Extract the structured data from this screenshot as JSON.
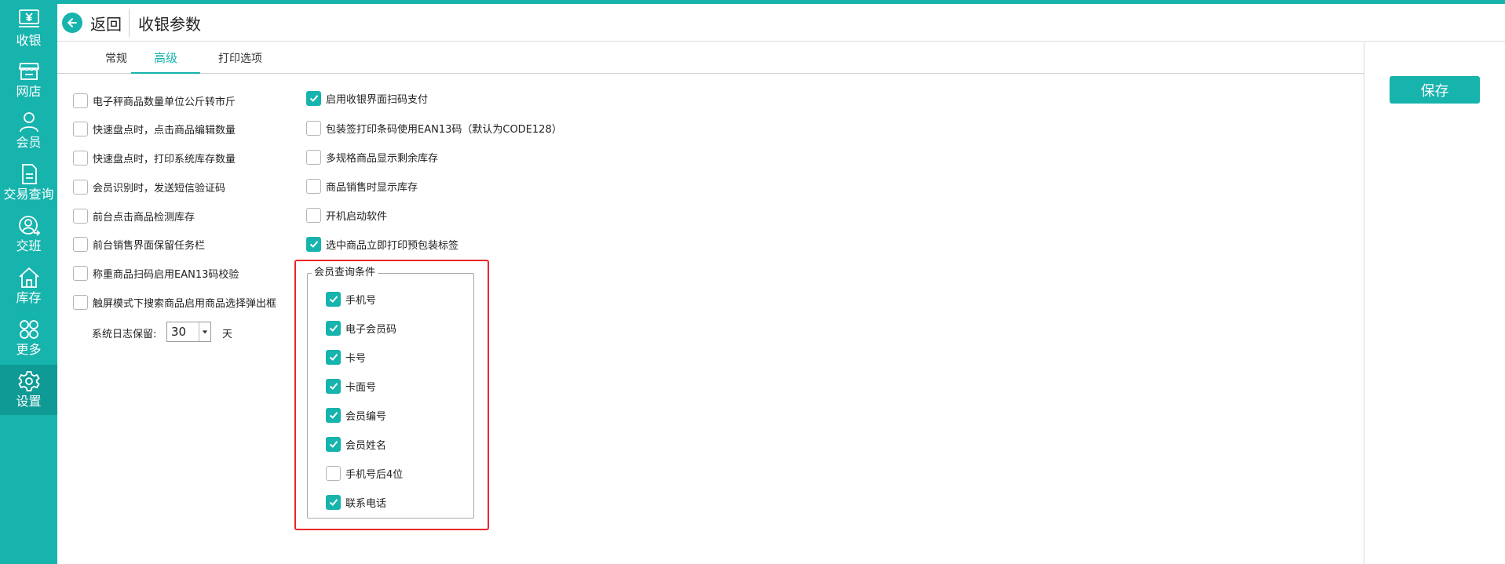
{
  "sidebar": {
    "items": [
      {
        "label": "收银",
        "icon": "cashier-yen-icon"
      },
      {
        "label": "网店",
        "icon": "store-icon"
      },
      {
        "label": "会员",
        "icon": "member-icon"
      },
      {
        "label": "交易查询",
        "icon": "transaction-document-icon"
      },
      {
        "label": "交班",
        "icon": "shift-handover-icon"
      },
      {
        "label": "库存",
        "icon": "inventory-house-icon"
      },
      {
        "label": "更多",
        "icon": "more-grid-icon"
      },
      {
        "label": "设置",
        "icon": "settings-gear-icon"
      }
    ],
    "active_item": "设置"
  },
  "header": {
    "back_label": "返回",
    "title": "收银参数"
  },
  "tabs": [
    {
      "label": "常规",
      "active": false
    },
    {
      "label": "高级",
      "active": true
    },
    {
      "label": "打印选项",
      "active": false
    }
  ],
  "toolbar": {
    "save_label": "保存"
  },
  "left_options": [
    {
      "label": "电子秤商品数量单位公斤转市斤",
      "checked": false
    },
    {
      "label": "快速盘点时，点击商品编辑数量",
      "checked": false
    },
    {
      "label": "快速盘点时，打印系统库存数量",
      "checked": false
    },
    {
      "label": "会员识别时，发送短信验证码",
      "checked": false
    },
    {
      "label": "前台点击商品检测库存",
      "checked": false
    },
    {
      "label": "前台销售界面保留任务栏",
      "checked": false
    },
    {
      "label": "称重商品扫码启用EAN13码校验",
      "checked": false
    },
    {
      "label": "触屏模式下搜索商品启用商品选择弹出框",
      "checked": false
    }
  ],
  "log_retention": {
    "label": "系统日志保留:",
    "value": "30",
    "unit": "天"
  },
  "right_options": [
    {
      "label": "启用收银界面扫码支付",
      "checked": true
    },
    {
      "label": "包装签打印条码使用EAN13码（默认为CODE128）",
      "checked": false
    },
    {
      "label": "多规格商品显示剩余库存",
      "checked": false
    },
    {
      "label": "商品销售时显示库存",
      "checked": false
    },
    {
      "label": "开机启动软件",
      "checked": false
    },
    {
      "label": "选中商品立即打印预包装标签",
      "checked": true
    }
  ],
  "member_query": {
    "title": "会员查询条件",
    "options": [
      {
        "label": "手机号",
        "checked": true
      },
      {
        "label": "电子会员码",
        "checked": true
      },
      {
        "label": "卡号",
        "checked": true
      },
      {
        "label": "卡面号",
        "checked": true
      },
      {
        "label": "会员编号",
        "checked": true
      },
      {
        "label": "会员姓名",
        "checked": true
      },
      {
        "label": "手机号后4位",
        "checked": false
      },
      {
        "label": "联系电话",
        "checked": true
      }
    ]
  },
  "colors": {
    "accent": "#17b3ad",
    "highlight": "#e8262a"
  }
}
